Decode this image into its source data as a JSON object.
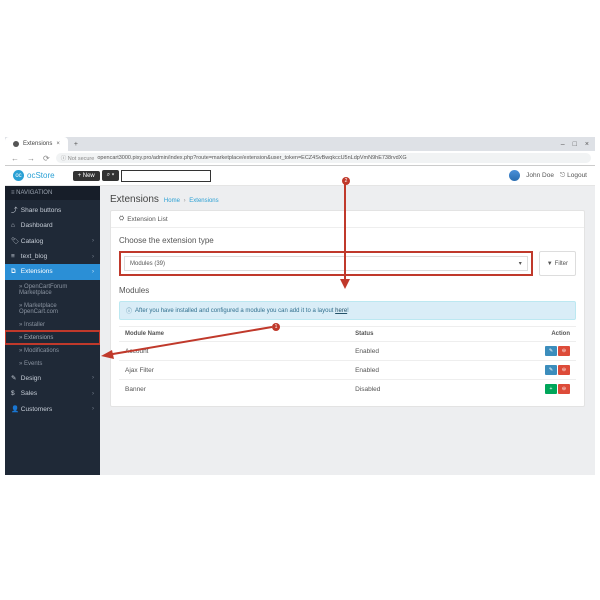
{
  "browser": {
    "tab_title": "Extensions",
    "new_tab": "+",
    "minimize": "–",
    "maximize": "□",
    "close": "×",
    "back": "←",
    "forward": "→",
    "reload": "⟳",
    "secure": "ⓘ Not secure",
    "url": "opencart3000.pixy.pro/admin/index.php?route=marketplace/extension&user_token=ECZ4SvBwqkccU5nLdpVmN9hE738rvdXG"
  },
  "header": {
    "logo": "ocStore",
    "new_btn": "+ New",
    "user": "John Doe",
    "logout": "Logout"
  },
  "sidebar": {
    "heading": "NAVIGATION",
    "items": [
      {
        "label": "Share buttons",
        "chev": false
      },
      {
        "label": "Dashboard",
        "chev": false
      },
      {
        "label": "Catalog",
        "chev": true
      },
      {
        "label": "text_blog",
        "chev": true
      },
      {
        "label": "Extensions",
        "chev": true,
        "active": true
      }
    ],
    "sub_items": [
      {
        "label": "OpenCartForum Marketplace"
      },
      {
        "label": "Marketplace OpenCart.com"
      },
      {
        "label": "Installer"
      },
      {
        "label": "Extensions",
        "highlight": true
      },
      {
        "label": "Modifications"
      },
      {
        "label": "Events"
      }
    ],
    "items_after": [
      {
        "label": "Design",
        "chev": true
      },
      {
        "label": "Sales",
        "chev": true
      },
      {
        "label": "Customers",
        "chev": true
      }
    ]
  },
  "page": {
    "title": "Extensions",
    "crumb_home": "Home",
    "crumb_sep": "›",
    "crumb_current": "Extensions",
    "panel_head": "Extension List",
    "choose_label": "Choose the extension type",
    "select_value": "Modules (39)",
    "filter_btn": "Filter",
    "modules_heading": "Modules",
    "alert": "After you have installed and configured a module you can add it to a layout",
    "alert_link": "here",
    "alert_tail": "!",
    "th_name": "Module Name",
    "th_status": "Status",
    "th_action": "Action",
    "rows": [
      {
        "name": "Account",
        "status": "Enabled",
        "style": "edit"
      },
      {
        "name": "Ajax Filter",
        "status": "Enabled",
        "style": "edit"
      },
      {
        "name": "Banner",
        "status": "Disabled",
        "style": "install"
      }
    ]
  },
  "annotations": {
    "callout1": "1",
    "callout2": "2"
  }
}
